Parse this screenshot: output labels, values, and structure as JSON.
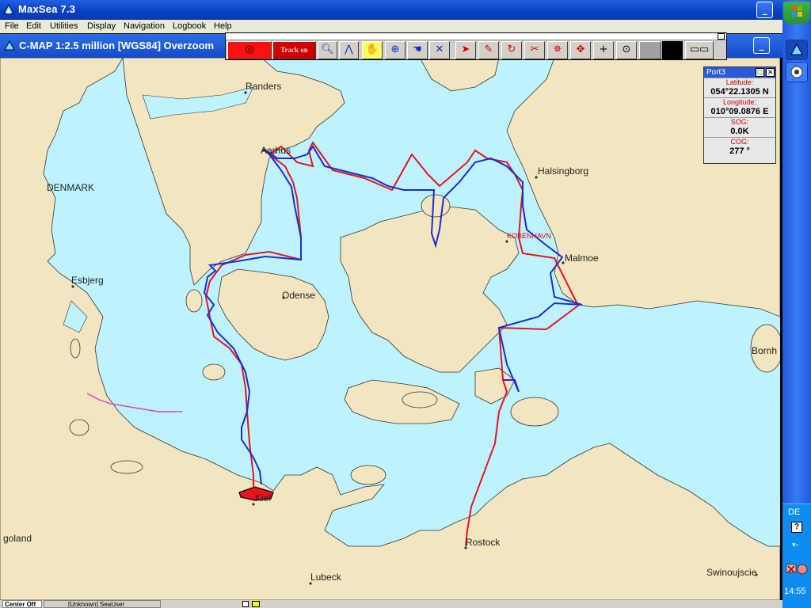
{
  "window": {
    "title": "MaxSea 7.3",
    "minimize_glyph": "_",
    "maximize_glyph": "□"
  },
  "menu": [
    "File",
    "Edit",
    "Utilities",
    "Display",
    "Navigation",
    "Logbook",
    "Help"
  ],
  "chart_window": {
    "title": "C-MAP  1:2.5 million [WGS84]    Overzoom",
    "minimize_glyph": "_"
  },
  "toolbar": {
    "track_label": "Track on",
    "icons": [
      "record-icon",
      "track-on",
      "zoom-icon",
      "compass-divider-icon",
      "hand-pan-icon",
      "center-crosshair-icon",
      "grab-icon",
      "route-icon",
      "pointer-arrow-icon",
      "pencil-icon",
      "rotate-icon",
      "scissors-icon",
      "mark-icon",
      "move-cross-icon",
      "plus-icon",
      "target-icon"
    ]
  },
  "places": [
    {
      "id": "randers",
      "name": "Randers"
    },
    {
      "id": "aarhus",
      "name": "Aarhus"
    },
    {
      "id": "denmark",
      "name": "DENMARK"
    },
    {
      "id": "esbjerg",
      "name": "Esbjerg"
    },
    {
      "id": "odense",
      "name": "Odense"
    },
    {
      "id": "halsingborg",
      "name": "Halsingborg"
    },
    {
      "id": "kobenhavn",
      "name": "KOBENHAVN"
    },
    {
      "id": "malmoe",
      "name": "Malmoe"
    },
    {
      "id": "bornholm",
      "name": "Bornh"
    },
    {
      "id": "kiel",
      "name": "Kiel"
    },
    {
      "id": "rostock",
      "name": "Rostock"
    },
    {
      "id": "lubeck",
      "name": "Lubeck"
    },
    {
      "id": "swinoujscie",
      "name": "Swinoujscie"
    },
    {
      "id": "helgoland",
      "name": "goland"
    }
  ],
  "port_panel": {
    "title": "Port3",
    "latitude_label": "Latitude:",
    "latitude": "054°22.1305 N",
    "longitude_label": "Longitude:",
    "longitude": "010°09.0876 E",
    "sog_label": "SOG:",
    "sog": "0.0K",
    "cog_label": "COG:",
    "cog": "277 °"
  },
  "status_bar": {
    "left": "Center Off",
    "user": "[Unknown] SeaUser"
  },
  "tray": {
    "language": "DE",
    "help": "?",
    "time": "14:55"
  },
  "colors": {
    "sea": "#bdf3ff",
    "land": "#f2e5c0",
    "route_red": "#e8141e",
    "track_blue": "#1a2fd0",
    "boundary_pink": "#e040c0"
  }
}
